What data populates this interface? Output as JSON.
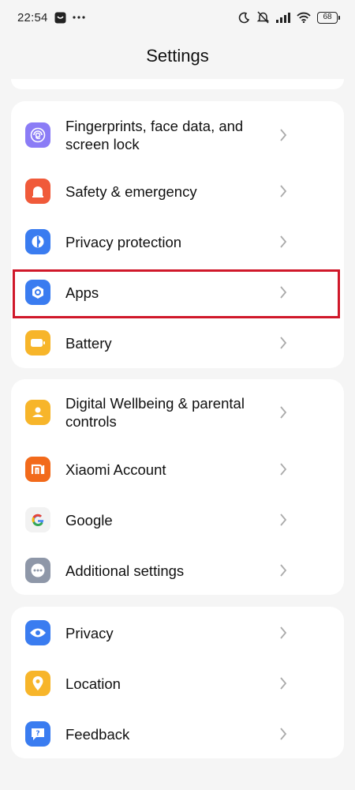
{
  "status_bar": {
    "time": "22:54",
    "battery": "68"
  },
  "header": {
    "title": "Settings"
  },
  "groups": [
    {
      "items": [
        {
          "label": "Fingerprints, face data, and screen lock",
          "icon": "fingerprint-icon",
          "color": "#8b7cf6"
        },
        {
          "label": "Safety & emergency",
          "icon": "emergency-bell-icon",
          "color": "#f05a3a"
        },
        {
          "label": "Privacy protection",
          "icon": "privacy-shield-icon",
          "color": "#3a7cf0"
        },
        {
          "label": "Apps",
          "icon": "apps-hexagon-icon",
          "color": "#3a7cf0"
        },
        {
          "label": "Battery",
          "icon": "battery-icon",
          "color": "#f7b52a"
        }
      ]
    },
    {
      "items": [
        {
          "label": "Digital Wellbeing & parental controls",
          "icon": "wellbeing-icon",
          "color": "#f7b52a"
        },
        {
          "label": "Xiaomi Account",
          "icon": "xiaomi-logo-icon",
          "color": "#f26a1b"
        },
        {
          "label": "Google",
          "icon": "google-logo-icon",
          "color": "#f2f2f2"
        },
        {
          "label": "Additional settings",
          "icon": "more-dots-icon",
          "color": "#8e97a8"
        }
      ]
    },
    {
      "items": [
        {
          "label": "Privacy",
          "icon": "eye-icon",
          "color": "#3a7cf0"
        },
        {
          "label": "Location",
          "icon": "location-pin-icon",
          "color": "#f7b52a"
        },
        {
          "label": "Feedback",
          "icon": "feedback-icon",
          "color": "#3a7cf0"
        }
      ]
    }
  ],
  "highlight_color": "#d0182a"
}
